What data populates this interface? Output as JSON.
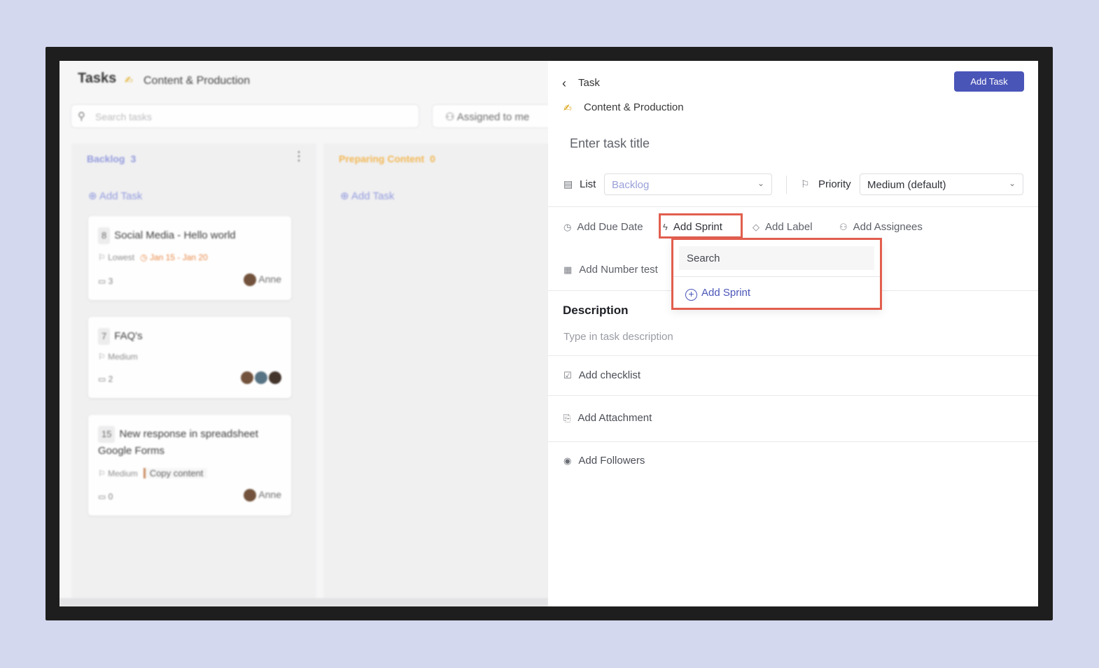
{
  "board": {
    "title": "Tasks",
    "project": "Content & Production",
    "search_placeholder": "Search tasks",
    "assigned_filter": "Assigned to me",
    "columns": [
      {
        "name": "Backlog",
        "count": "3",
        "add_label": "Add Task"
      },
      {
        "name": "Preparing Content",
        "count": "0",
        "add_label": "Add Task"
      }
    ],
    "cards": [
      {
        "id": "8",
        "title": "Social Media - Hello world",
        "priority": "Lowest",
        "date": "Jan 15 - Jan 20",
        "comments": "3",
        "user": "Anne"
      },
      {
        "id": "7",
        "title": "FAQ's",
        "priority": "Medium",
        "comments": "2"
      },
      {
        "id": "15",
        "title": "New response in spreadsheet Google Forms",
        "priority": "Medium",
        "label": "Copy content",
        "comments": "0",
        "user": "Anne"
      }
    ]
  },
  "panel": {
    "back_label": "Task",
    "add_task_button": "Add Task",
    "project_emoji": "✍",
    "project_name": "Content & Production",
    "title_placeholder": "Enter task title",
    "list_label": "List",
    "list_value": "Backlog",
    "priority_label": "Priority",
    "priority_value": "Medium (default)",
    "attributes": {
      "due_date": "Add Due Date",
      "sprint": "Add Sprint",
      "label": "Add Label",
      "assignees": "Add Assignees",
      "number_test": "Add Number test"
    },
    "description_title": "Description",
    "description_placeholder": "Type in task description",
    "checklist": "Add checklist",
    "attachment": "Add Attachment",
    "followers": "Add Followers"
  },
  "sprint_dropdown": {
    "search_placeholder": "Search",
    "add_label": "Add Sprint"
  },
  "colors": {
    "accent": "#4a55b8",
    "highlight": "#e25e4e",
    "backdrop": "#d4d8ee"
  }
}
